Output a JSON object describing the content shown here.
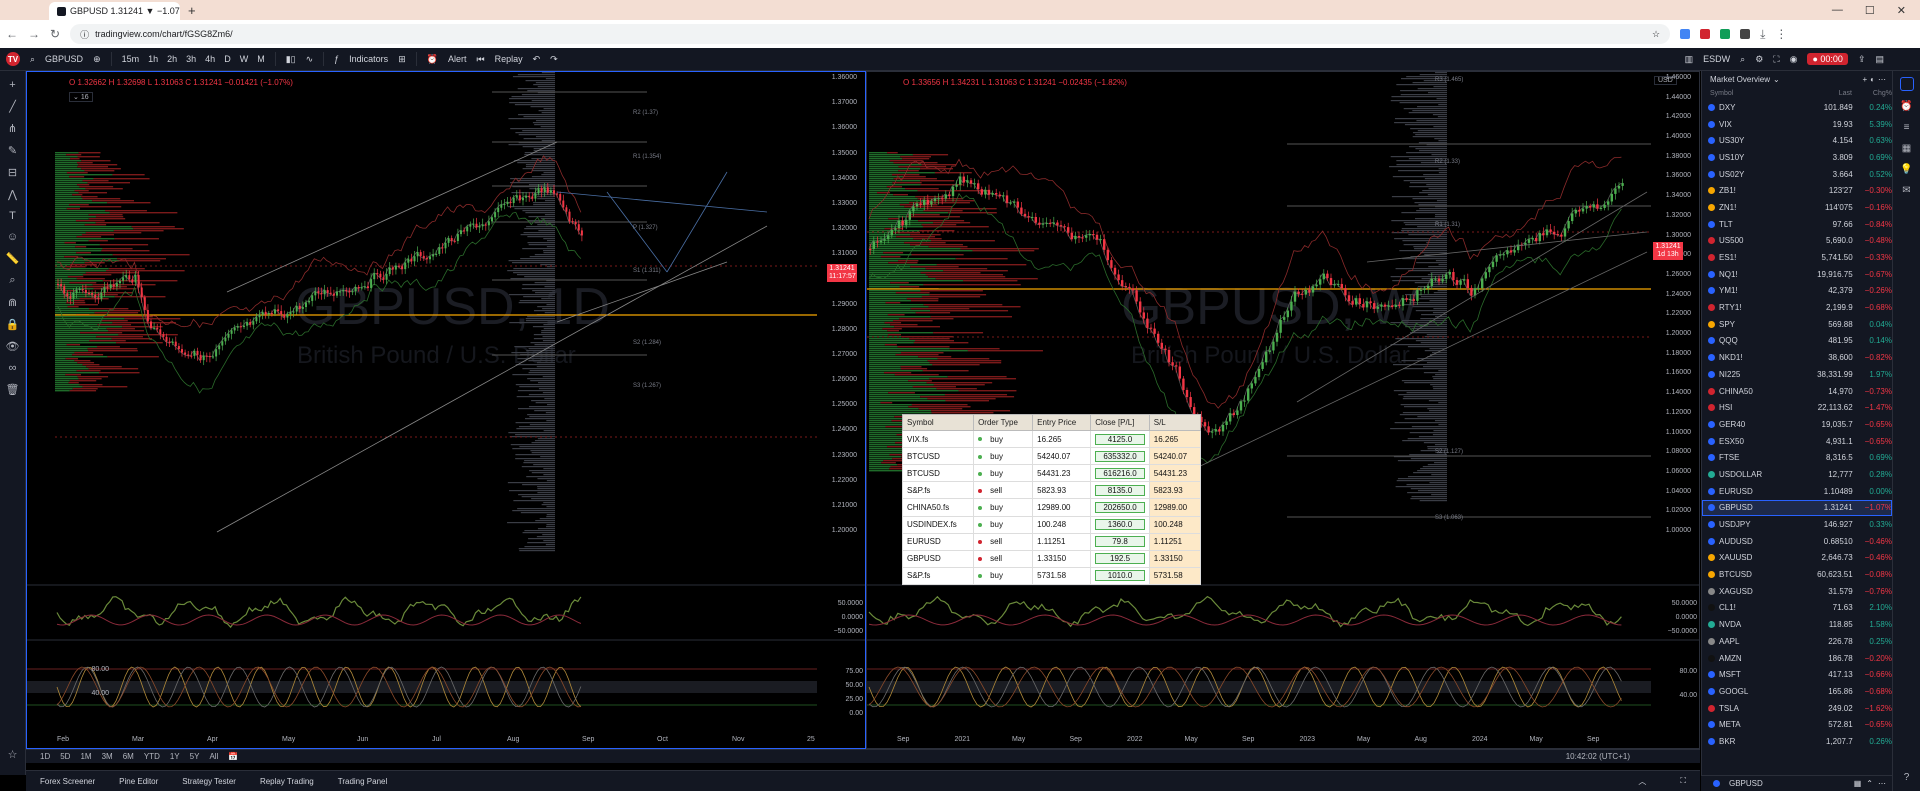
{
  "browser": {
    "tab_title": "GBPUSD 1.31241 ▼ −1.07%",
    "url": "tradingview.com/chart/fGSG8Zm6/"
  },
  "toolbar": {
    "symbol": "GBPUSD",
    "intervals": [
      "15m",
      "1h",
      "2h",
      "3h",
      "4h",
      "D",
      "W",
      "M"
    ],
    "indicators_label": "Indicators",
    "alert_label": "Alert",
    "replay_label": "Replay",
    "layout_name": "ESDW",
    "record_time": "00:00"
  },
  "left_chart": {
    "ohlc": "O 1.32662  H 1.32698  L 1.31063  C 1.31241  −0.01421 (−1.07%)",
    "indicator_count": "16",
    "watermark": "GBPUSD, 1D",
    "watermark_sub": "British Pound / U.S. Dollar",
    "price_tag": "1.31241",
    "price_tag_sub": "11:17:57",
    "y_labels": [
      "1.36000",
      "1.37000",
      "1.36000",
      "1.35000",
      "1.34000",
      "1.33000",
      "1.32000",
      "1.31000",
      "1.30000",
      "1.29000",
      "1.28000",
      "1.27000",
      "1.26000",
      "1.25000",
      "1.24000",
      "1.23000",
      "1.22000",
      "1.21000",
      "1.20000"
    ],
    "x_labels": [
      "Feb",
      "Mar",
      "Apr",
      "May",
      "Jun",
      "Jul",
      "Aug",
      "Sep",
      "Oct",
      "Nov",
      "25"
    ],
    "pivot_labels": [
      "R2 (1.37)",
      "R1 (1.354)",
      "P (1.327)",
      "S1 (1.311)",
      "S2 (1.284)",
      "S3 (1.267)"
    ],
    "osc1_labels": [
      "50.0000",
      "0.0000",
      "−50.0000"
    ],
    "osc2_labels": [
      "80.00",
      "40.00"
    ],
    "osc2_right": [
      "75.00",
      "50.00",
      "25.00",
      "0.00"
    ]
  },
  "right_chart": {
    "ohlc": "O 1.33656  H 1.34231  L 1.31063  C 1.31241  −0.02435 (−1.82%)",
    "watermark": "GBPUSD, W",
    "watermark_sub": "British Pound / U.S. Dollar",
    "price_tag": "1.31241",
    "price_tag_sub": "1d 13h",
    "y_labels": [
      "1.46000",
      "1.44000",
      "1.42000",
      "1.40000",
      "1.38000",
      "1.36000",
      "1.34000",
      "1.32000",
      "1.30000",
      "1.28000",
      "1.26000",
      "1.24000",
      "1.22000",
      "1.20000",
      "1.18000",
      "1.16000",
      "1.14000",
      "1.12000",
      "1.10000",
      "1.08000",
      "1.06000",
      "1.04000",
      "1.02000",
      "1.00000"
    ],
    "x_labels": [
      "Sep",
      "2021",
      "May",
      "Sep",
      "2022",
      "May",
      "Sep",
      "2023",
      "May",
      "Aug",
      "2024",
      "May",
      "Sep"
    ],
    "pivot_labels": [
      "R3 (1.465)",
      "R2 (1.33)",
      "R1 (1.31)",
      "S2 (1.127)",
      "S3 (1.063)"
    ],
    "currency": "USD",
    "osc1_labels": [
      "50.0000",
      "0.0000",
      "−50.0000"
    ],
    "osc2_labels": [
      "80.00",
      "40.00"
    ]
  },
  "orders": {
    "headers": [
      "Symbol",
      "Order Type",
      "Entry Price",
      "Close [P/L]",
      "S/L"
    ],
    "rows": [
      {
        "symbol": "VIX.fs",
        "type": "buy",
        "entry": "16.265",
        "close": "4125.0",
        "sl": "16.265"
      },
      {
        "symbol": "BTCUSD",
        "type": "buy",
        "entry": "54240.07",
        "close": "635332.0",
        "sl": "54240.07"
      },
      {
        "symbol": "BTCUSD",
        "type": "buy",
        "entry": "54431.23",
        "close": "616216.0",
        "sl": "54431.23"
      },
      {
        "symbol": "S&P.fs",
        "type": "sell",
        "entry": "5823.93",
        "close": "8135.0",
        "sl": "5823.93"
      },
      {
        "symbol": "CHINA50.fs",
        "type": "buy",
        "entry": "12989.00",
        "close": "202650.0",
        "sl": "12989.00"
      },
      {
        "symbol": "USDINDEX.fs",
        "type": "buy",
        "entry": "100.248",
        "close": "1360.0",
        "sl": "100.248"
      },
      {
        "symbol": "EURUSD",
        "type": "sell",
        "entry": "1.11251",
        "close": "79.8",
        "sl": "1.11251"
      },
      {
        "symbol": "GBPUSD",
        "type": "sell",
        "entry": "1.33150",
        "close": "192.5",
        "sl": "1.33150"
      },
      {
        "symbol": "S&P.fs",
        "type": "buy",
        "entry": "5731.58",
        "close": "1010.0",
        "sl": "5731.58"
      }
    ],
    "colors": {
      "buy": "#4caf50",
      "sell": "#d1242f"
    }
  },
  "range_bar": {
    "ranges": [
      "1D",
      "5D",
      "1M",
      "3M",
      "6M",
      "YTD",
      "1Y",
      "5Y",
      "All"
    ],
    "clock": "10:42:02 (UTC+1)"
  },
  "bottom_tabs": [
    "Forex Screener",
    "Pine Editor",
    "Strategy Tester",
    "Replay Trading",
    "Trading Panel"
  ],
  "watchlist": {
    "title": "Market Overview",
    "headers": {
      "symbol": "Symbol",
      "last": "Last",
      "chg": "Chg%"
    },
    "footer_symbol": "GBPUSD",
    "rows": [
      {
        "sym": "DXY",
        "last": "101.849",
        "chg": "0.24%",
        "dir": "up",
        "color": "#2962ff"
      },
      {
        "sym": "VIX",
        "last": "19.93",
        "chg": "5.39%",
        "dir": "up",
        "color": "#2962ff"
      },
      {
        "sym": "US30Y",
        "last": "4.154",
        "chg": "0.63%",
        "dir": "up",
        "color": "#2962ff"
      },
      {
        "sym": "US10Y",
        "last": "3.809",
        "chg": "0.69%",
        "dir": "up",
        "color": "#2962ff"
      },
      {
        "sym": "US02Y",
        "last": "3.664",
        "chg": "0.52%",
        "dir": "up",
        "color": "#2962ff"
      },
      {
        "sym": "ZB1!",
        "last": "123'27",
        "chg": "−0.30%",
        "dir": "dn",
        "color": "#f7a600"
      },
      {
        "sym": "ZN1!",
        "last": "114'075",
        "chg": "−0.16%",
        "dir": "dn",
        "color": "#f7a600"
      },
      {
        "sym": "TLT",
        "last": "97.66",
        "chg": "−0.84%",
        "dir": "dn",
        "color": "#2962ff"
      },
      {
        "sym": "US500",
        "last": "5,690.0",
        "chg": "−0.48%",
        "dir": "dn",
        "color": "#d1242f"
      },
      {
        "sym": "ES1!",
        "last": "5,741.50",
        "chg": "−0.33%",
        "dir": "dn",
        "color": "#d1242f"
      },
      {
        "sym": "NQ1!",
        "last": "19,916.75",
        "chg": "−0.67%",
        "dir": "dn",
        "color": "#2962ff"
      },
      {
        "sym": "YM1!",
        "last": "42,379",
        "chg": "−0.26%",
        "dir": "dn",
        "color": "#2962ff"
      },
      {
        "sym": "RTY1!",
        "last": "2,199.9",
        "chg": "−0.68%",
        "dir": "dn",
        "color": "#d1242f"
      },
      {
        "sym": "SPY",
        "last": "569.88",
        "chg": "0.04%",
        "dir": "up",
        "color": "#f7a600"
      },
      {
        "sym": "QQQ",
        "last": "481.95",
        "chg": "0.14%",
        "dir": "up",
        "color": "#2962ff"
      },
      {
        "sym": "NKD1!",
        "last": "38,600",
        "chg": "−0.82%",
        "dir": "dn",
        "color": "#2962ff"
      },
      {
        "sym": "NI225",
        "last": "38,331.99",
        "chg": "1.97%",
        "dir": "up",
        "color": "#2962ff"
      },
      {
        "sym": "CHINA50",
        "last": "14,970",
        "chg": "−0.73%",
        "dir": "dn",
        "color": "#d1242f"
      },
      {
        "sym": "HSI",
        "last": "22,113.62",
        "chg": "−1.47%",
        "dir": "dn",
        "color": "#d1242f"
      },
      {
        "sym": "GER40",
        "last": "19,035.7",
        "chg": "−0.65%",
        "dir": "dn",
        "color": "#2962ff"
      },
      {
        "sym": "ESX50",
        "last": "4,931.1",
        "chg": "−0.65%",
        "dir": "dn",
        "color": "#2962ff"
      },
      {
        "sym": "FTSE",
        "last": "8,316.5",
        "chg": "0.69%",
        "dir": "up",
        "color": "#2962ff"
      },
      {
        "sym": "USDOLLAR",
        "last": "12,777",
        "chg": "0.28%",
        "dir": "up",
        "color": "#22ab94"
      },
      {
        "sym": "EURUSD",
        "last": "1.10489",
        "chg": "0.00%",
        "dir": "up",
        "color": "#2962ff"
      },
      {
        "sym": "GBPUSD",
        "last": "1.31241",
        "chg": "−1.07%",
        "dir": "dn",
        "color": "#2962ff",
        "sel": true
      },
      {
        "sym": "USDJPY",
        "last": "146.927",
        "chg": "0.33%",
        "dir": "up",
        "color": "#2962ff"
      },
      {
        "sym": "AUDUSD",
        "last": "0.68510",
        "chg": "−0.46%",
        "dir": "dn",
        "color": "#2962ff"
      },
      {
        "sym": "XAUUSD",
        "last": "2,646.73",
        "chg": "−0.46%",
        "dir": "dn",
        "color": "#f7a600"
      },
      {
        "sym": "BTCUSD",
        "last": "60,623.51",
        "chg": "−0.08%",
        "dir": "dn",
        "color": "#f7a600"
      },
      {
        "sym": "XAGUSD",
        "last": "31.579",
        "chg": "−0.76%",
        "dir": "dn",
        "color": "#888888"
      },
      {
        "sym": "CL1!",
        "last": "71.63",
        "chg": "2.10%",
        "dir": "up",
        "color": "#111111"
      },
      {
        "sym": "NVDA",
        "last": "118.85",
        "chg": "1.58%",
        "dir": "up",
        "color": "#22ab94"
      },
      {
        "sym": "AAPL",
        "last": "226.78",
        "chg": "0.25%",
        "dir": "up",
        "color": "#888888"
      },
      {
        "sym": "AMZN",
        "last": "186.78",
        "chg": "−0.20%",
        "dir": "dn",
        "color": "#111111"
      },
      {
        "sym": "MSFT",
        "last": "417.13",
        "chg": "−0.66%",
        "dir": "dn",
        "color": "#2962ff"
      },
      {
        "sym": "GOOGL",
        "last": "165.86",
        "chg": "−0.68%",
        "dir": "dn",
        "color": "#2962ff"
      },
      {
        "sym": "TSLA",
        "last": "249.02",
        "chg": "−1.62%",
        "dir": "dn",
        "color": "#d1242f"
      },
      {
        "sym": "META",
        "last": "572.81",
        "chg": "−0.65%",
        "dir": "dn",
        "color": "#2962ff"
      },
      {
        "sym": "BKR",
        "last": "1,207.7",
        "chg": "0.26%",
        "dir": "up",
        "color": "#2962ff"
      }
    ]
  }
}
